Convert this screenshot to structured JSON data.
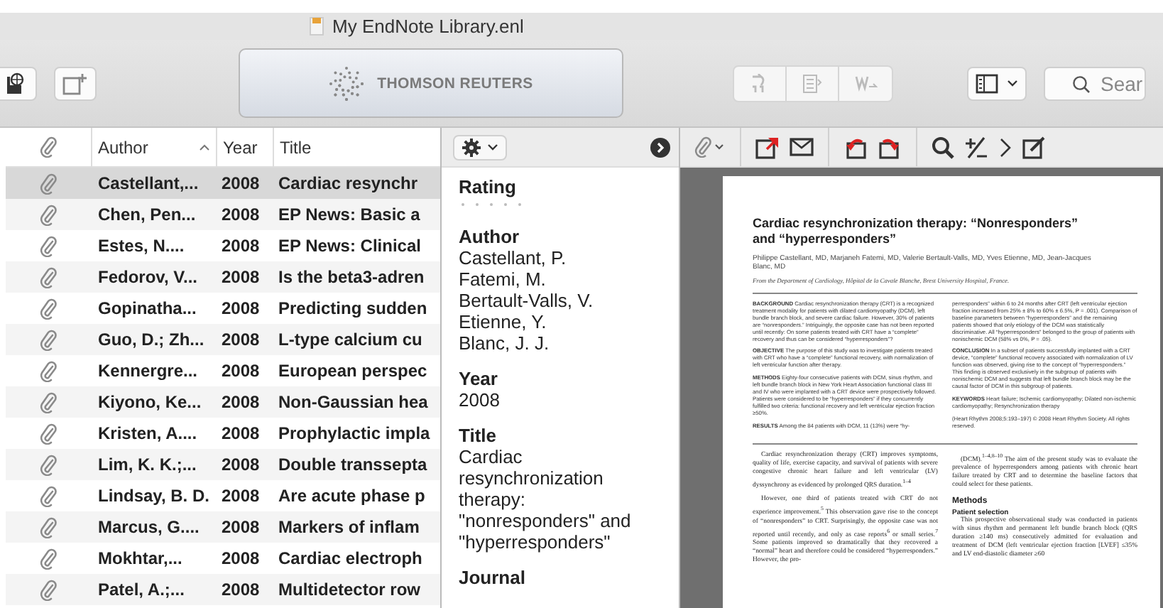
{
  "window": {
    "title": "My EndNote Library.enl"
  },
  "toolbar": {
    "banner": "THOMSON REUTERS",
    "search": {
      "placeholder": "Sear"
    }
  },
  "reference_list": {
    "columns": [
      {
        "label": "Author",
        "sorted": true
      },
      {
        "label": "Year",
        "sorted": false
      },
      {
        "label": "Title",
        "sorted": false
      }
    ],
    "rows": [
      {
        "author": "Castellant,...",
        "year": "2008",
        "title": "Cardiac resynchr",
        "selected": true
      },
      {
        "author": "Chen, Pen...",
        "year": "2008",
        "title": "EP News: Basic a",
        "selected": false
      },
      {
        "author": "Estes, N....",
        "year": "2008",
        "title": "EP News: Clinical",
        "selected": false
      },
      {
        "author": "Fedorov, V...",
        "year": "2008",
        "title": "Is the beta3-adren",
        "selected": false
      },
      {
        "author": "Gopinatha...",
        "year": "2008",
        "title": "Predicting sudden",
        "selected": false
      },
      {
        "author": "Guo, D.; Zh...",
        "year": "2008",
        "title": "L-type calcium cu",
        "selected": false
      },
      {
        "author": "Kennergre...",
        "year": "2008",
        "title": "European perspec",
        "selected": false
      },
      {
        "author": "Kiyono, Ke...",
        "year": "2008",
        "title": "Non-Gaussian hea",
        "selected": false
      },
      {
        "author": "Kristen, A....",
        "year": "2008",
        "title": "Prophylactic impla",
        "selected": false
      },
      {
        "author": "Lim, K. K.;...",
        "year": "2008",
        "title": "Double transsepta",
        "selected": false
      },
      {
        "author": "Lindsay, B. D.",
        "year": "2008",
        "title": "Are acute phase p",
        "selected": false
      },
      {
        "author": "Marcus, G....",
        "year": "2008",
        "title": "Markers of inflam",
        "selected": false
      },
      {
        "author": "Mokhtar,...",
        "year": "2008",
        "title": "Cardiac electroph",
        "selected": false
      },
      {
        "author": "Patel, A.;...",
        "year": "2008",
        "title": "Multidetector row",
        "selected": false
      }
    ]
  },
  "detail": {
    "fields": [
      {
        "kind": "rating",
        "label": "Rating",
        "stars": 0
      },
      {
        "kind": "text",
        "label": "Author",
        "lines": [
          "Castellant, P.",
          "Fatemi, M.",
          "Bertault-Valls, V.",
          "Etienne, Y.",
          "Blanc, J. J."
        ]
      },
      {
        "kind": "text",
        "label": "Year",
        "lines": [
          "2008"
        ]
      },
      {
        "kind": "text",
        "label": "Title",
        "lines": [
          "Cardiac resynchronization therapy: \"nonresponders\" and \"hyperresponders\""
        ]
      },
      {
        "kind": "text",
        "label": "Journal"
      }
    ]
  },
  "pdf": {
    "title": "Cardiac resynchronization therapy: “Nonresponders” and “hyperresponders”",
    "authors": "Philippe Castellant, MD, Marjaneh Fatemi, MD, Valerie Bertault-Valls, MD, Yves Etienne, MD, Jean-Jacques Blanc, MD",
    "affiliation": "From the Department of Cardiology, Hôpital de la Cavale Blanche, Brest University Hospital, France.",
    "abstract": [
      [
        {
          "kind": "paragraph",
          "text": "**BACKGROUND** Cardiac resynchronization therapy (CRT) is a recognized treatment modality for patients with dilated cardiomyopathy (DCM), left bundle branch block, and severe cardiac failure. However, 30% of patients are “nonresponders.” Intriguingly, the opposite case has not been reported until recently: On some patients treated with CRT have a “complete” recovery and thus can be considered “hyperresponders”?"
        },
        {
          "kind": "paragraph",
          "text": "**OBJECTIVE** The purpose of this study was to investigate patients treated with CRT who have a “complete” functional recovery, with normalization of left ventricular function after therapy."
        },
        {
          "kind": "paragraph",
          "text": "**METHODS** Eighty-four consecutive patients with DCM, sinus rhythm, and left bundle branch block in New York Heart Association functional class III and IV who were implanted with a CRT device were prospectively followed. Patients were considered to be “hyperresponders” if they concurrently fulfilled two criteria: functional recovery and left ventricular ejection fraction ≥50%."
        },
        {
          "kind": "paragraph",
          "text": "**RESULTS** Among the 84 patients with DCM, 11 (13%) were “hy-"
        }
      ],
      [
        {
          "kind": "paragraph",
          "text": "perresponders” within 6 to 24 months after CRT (left ventricular ejection fraction increased from 25% ± 8% to 60% ± 6.5%, P = .001). Comparison of baseline parameters between “hyperresponders” and the remaining patients showed that only etiology of the DCM was statistically discriminative. All “hyperresponders” belonged to the group of patients with nonischemic DCM (58% vs 0%, P = .05)."
        },
        {
          "kind": "paragraph",
          "text": "**CONCLUSION** In a subset of patients successfully implanted with a CRT device, “complete” functional recovery associated with normalization of LV function was observed, giving rise to the concept of “hyperresponders.” This finding is observed exclusively in the subgroup of patients with nonischemic DCM and suggests that left bundle branch block may be the causal factor of DCM in this subgroup of patients."
        },
        {
          "kind": "paragraph",
          "text": "**KEYWORDS** Heart failure; Ischemic cardiomyopathy; Dilated non-ischemic cardiomyopathy; Resynchronization therapy"
        },
        {
          "kind": "paragraph",
          "text": "(Heart Rhythm 2008;5:193–197) © 2008 Heart Rhythm Society. All rights reserved."
        }
      ]
    ],
    "body": [
      [
        {
          "kind": "paragraph",
          "text": "Cardiac resynchronization therapy (CRT) improves symptoms, quality of life, exercise capacity, and survival of patients with severe congestive chronic heart failure and left ventricular (LV) dyssynchrony as evidenced by prolonged QRS duration.$^{1–4}$"
        },
        {
          "kind": "paragraph",
          "text": "However, one third of patients treated with CRT do not experience improvement.$^{5}$ This observation gave rise to the concept of “nonresponders” to CRT. Surprisingly, the opposite case was not reported until recently, and only as case reports$^{6}$ or small series.$^{7}$ Some patients improved so dramatically that they recovered a “normal” heart and therefore could be considered “hyperresponders.” However, the pro-"
        }
      ],
      [
        {
          "kind": "paragraph",
          "text": "(DCM).$^{1–4,8–10}$ The aim of the present study was to evaluate the prevalence of hyperresponders among patients with chronic heart failure treated by CRT and to determine the baseline factors that could select for these patients."
        },
        {
          "kind": "heading",
          "text": "Methods"
        },
        {
          "kind": "subheading",
          "text": "Patient selection"
        },
        {
          "kind": "paragraph",
          "text": "This prospective observational study was conducted in patients with sinus rhythm and permanent left bundle branch block (QRS duration ≥140 ms) consecutively admitted for evaluation and treatment of DCM (left ventricular ejection fraction [LVEF] ≤35% and LV end-diastolic diameter ≥60"
        }
      ]
    ]
  }
}
